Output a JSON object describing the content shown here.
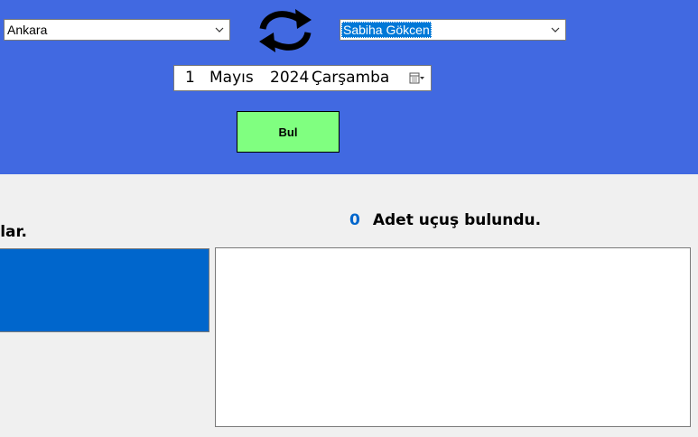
{
  "search": {
    "from_city": "Ankara",
    "to_airport": "Sabiha Gökcen",
    "swap_icon": "swap-arrows-icon",
    "date": {
      "day": "1",
      "month": "Mayıs",
      "year": "2024",
      "weekday": "Çarşamba",
      "picker_icon": "calendar-dropdown-icon"
    },
    "find_button_label": "Bul"
  },
  "left": {
    "label_partial": "uşlar."
  },
  "results": {
    "count": "0",
    "count_label": "Adet uçuş bulundu."
  },
  "colors": {
    "header_bg": "#4169e1",
    "find_button_bg": "#80ff80",
    "left_panel_bg": "#0066cc",
    "count_color": "#0066cc",
    "body_bg": "#f0f0f0"
  }
}
